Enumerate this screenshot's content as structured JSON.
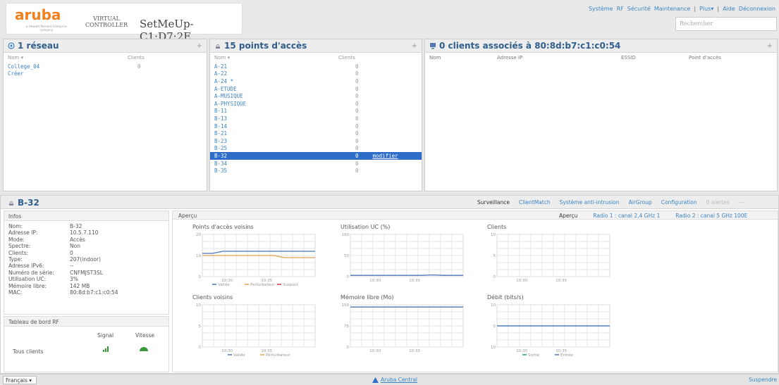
{
  "brand": {
    "logo": "aruba",
    "logo_sub": "a Hewlett Packard Enterprise company",
    "vc_line1": "VIRTUAL",
    "vc_line2": "CONTROLLER",
    "name": "SetMeUp-C1:D7:2E"
  },
  "topmenu": {
    "items": [
      "Système",
      "RF",
      "Sécurité",
      "Maintenance"
    ],
    "plus": "Plus▾",
    "aide": "Aide",
    "deconnexion": "Déconnexion"
  },
  "search": {
    "placeholder": "Rechercher"
  },
  "networks": {
    "title": "1 réseau",
    "col_name": "Nom ▾",
    "col_clients": "Clients",
    "rows": [
      {
        "name": "College_04",
        "clients": "0"
      }
    ],
    "create": "Créer"
  },
  "aps": {
    "title": "15 points d'accès",
    "col_name": "Nom ▾",
    "col_clients": "Clients",
    "modify": "modifier",
    "rows": [
      {
        "name": "A-21",
        "clients": "0"
      },
      {
        "name": "A-22",
        "clients": "0"
      },
      {
        "name": "A-24 *",
        "clients": "0"
      },
      {
        "name": "A-ETUDE",
        "clients": "0"
      },
      {
        "name": "A-MUSIQUE",
        "clients": "0"
      },
      {
        "name": "A-PHYSIQUE",
        "clients": "0"
      },
      {
        "name": "B-11",
        "clients": "0"
      },
      {
        "name": "B-13",
        "clients": "0"
      },
      {
        "name": "B-14",
        "clients": "0"
      },
      {
        "name": "B-21",
        "clients": "0"
      },
      {
        "name": "B-23",
        "clients": "0"
      },
      {
        "name": "B-25",
        "clients": "0"
      },
      {
        "name": "B-32",
        "clients": "0"
      },
      {
        "name": "B-34",
        "clients": "0"
      },
      {
        "name": "B-35",
        "clients": "0"
      }
    ]
  },
  "clients": {
    "title": "0 clients associés à 80:8d:b7:c1:c0:54",
    "cols": [
      "Nom",
      "Adresse IP",
      "ESSID",
      "Point d'accès"
    ]
  },
  "detail": {
    "title": "B-32",
    "tabs": [
      "Surveillance",
      "ClientMatch",
      "Système anti-intrusion",
      "AirGroup",
      "Configuration",
      "0 alertes"
    ],
    "collapse": "—"
  },
  "infos": {
    "header": "Infos",
    "rows": [
      {
        "k": "Nom:",
        "v": "B-32"
      },
      {
        "k": "Adresse IP:",
        "v": "10.5.7.110"
      },
      {
        "k": "Mode:",
        "v": "Accès"
      },
      {
        "k": "Spectre:",
        "v": "Non"
      },
      {
        "k": "Clients:",
        "v": "0"
      },
      {
        "k": "Type:",
        "v": "207(indoor)"
      },
      {
        "k": "Adresse IPv6:",
        "v": "--"
      },
      {
        "k": "Numéro de série:",
        "v": "CNFMJST3SL"
      },
      {
        "k": "Utilisation UC:",
        "v": "3%"
      },
      {
        "k": "Mémoire libre:",
        "v": "142 MB"
      },
      {
        "k": "MAC:",
        "v": "80:8d:b7:c1:c0:54"
      }
    ]
  },
  "rf": {
    "header": "Tableau de bord RF",
    "col_signal": "Signal",
    "col_vitesse": "Vitesse",
    "row_label": "Tous clients"
  },
  "apercu": {
    "header": "Aperçu",
    "tabs": [
      "Aperçu",
      "Radio 1 : canal 2,4 GHz 1",
      "Radio 2 : canal 5 GHz 100E"
    ]
  },
  "charts": [
    {
      "title": "Points d'accès voisins",
      "ymax": 20,
      "yticks": [
        "20",
        "10",
        "0"
      ],
      "xticks": [
        "10:30",
        "10:35"
      ],
      "legend": [
        "Valide",
        "Perturbateur",
        "Suspect"
      ],
      "colors": [
        "#4a73b8",
        "#e0a050",
        "#d23b3b"
      ],
      "series": [
        [
          11,
          11,
          12,
          12,
          12,
          12,
          12,
          12,
          12,
          12,
          12,
          12
        ],
        [
          10,
          10,
          10,
          10,
          10,
          10,
          10,
          10,
          9,
          9,
          9,
          9
        ]
      ]
    },
    {
      "title": "Utilisation UC  (%)",
      "ymax": 100,
      "yticks": [
        "100",
        "50",
        "0"
      ],
      "xticks": [
        "10:30",
        "10:35"
      ],
      "legend": [],
      "colors": [
        "#4a73b8"
      ],
      "series": [
        [
          3,
          3,
          3,
          3,
          3,
          3,
          3,
          3,
          4,
          3,
          3,
          3
        ]
      ]
    },
    {
      "title": "Clients",
      "ymax": 10,
      "yticks": [
        "10",
        "5",
        "0"
      ],
      "xticks": [
        "10:30",
        "10:35"
      ],
      "legend": [],
      "colors": [
        "#4a73b8"
      ],
      "series": []
    },
    {
      "title": "Clients voisins",
      "ymax": 10,
      "yticks": [
        "10",
        "5",
        "0"
      ],
      "xticks": [
        "10:30",
        "10:35"
      ],
      "legend": [
        "Valide",
        "Perturbateur"
      ],
      "colors": [
        "#4a73b8",
        "#e0a050"
      ],
      "series": []
    },
    {
      "title": "Mémoire libre  (Mo)",
      "ymax": 150,
      "yticks": [
        "150",
        "75",
        "0"
      ],
      "xticks": [
        "10:30",
        "10:35"
      ],
      "legend": [],
      "colors": [
        "#4a73b8"
      ],
      "series": [
        [
          142,
          142,
          142,
          142,
          142,
          142,
          142,
          142,
          142,
          142,
          142,
          142
        ]
      ]
    },
    {
      "title": "Débit  (bits/s)",
      "ymax": 10,
      "ymin": -10,
      "yticks": [
        "10",
        "0",
        "10"
      ],
      "xticks": [
        "10:30",
        "10:35"
      ],
      "legend": [
        "Sortie",
        "Entrée"
      ],
      "colors": [
        "#2a9d8f",
        "#4a73b8"
      ],
      "series": [
        [
          0,
          0,
          0,
          0,
          0,
          0,
          0,
          0,
          0,
          0,
          0,
          0
        ],
        [
          0,
          0,
          0,
          0,
          0,
          0,
          0,
          0,
          0,
          0,
          0,
          0
        ]
      ]
    }
  ],
  "footer": {
    "lang": "Français ▾",
    "central": "Aruba Central",
    "suspend": "Suspendre"
  }
}
